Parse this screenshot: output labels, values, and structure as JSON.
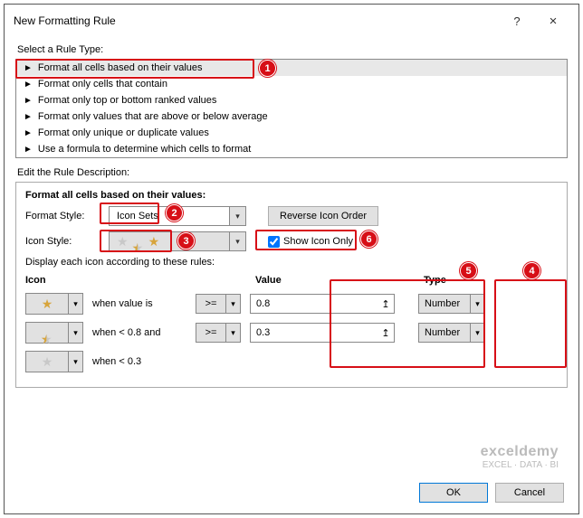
{
  "title": "New Formatting Rule",
  "select_rule_label": "Select a Rule Type:",
  "rule_types": [
    "Format all cells based on their values",
    "Format only cells that contain",
    "Format only top or bottom ranked values",
    "Format only values that are above or below average",
    "Format only unique or duplicate values",
    "Use a formula to determine which cells to format"
  ],
  "edit_desc_label": "Edit the Rule Description:",
  "desc_title": "Format all cells based on their values:",
  "format_style_label": "Format Style:",
  "format_style_value": "Icon Sets",
  "reverse_btn": "Reverse Icon Order",
  "icon_style_label": "Icon Style:",
  "show_icon_only_label": "Show Icon Only",
  "display_rule_label": "Display each icon according to these rules:",
  "col_icon": "Icon",
  "col_value": "Value",
  "col_type": "Type",
  "rows": [
    {
      "cond": "when value is",
      "op": ">=",
      "value": "0.8",
      "type": "Number"
    },
    {
      "cond": "when < 0.8 and",
      "op": ">=",
      "value": "0.3",
      "type": "Number"
    },
    {
      "cond": "when  < 0.3",
      "op": "",
      "value": "",
      "type": ""
    }
  ],
  "ok": "OK",
  "cancel": "Cancel",
  "watermark": {
    "lg": "exceldemy",
    "sm": "EXCEL · DATA · BI"
  }
}
